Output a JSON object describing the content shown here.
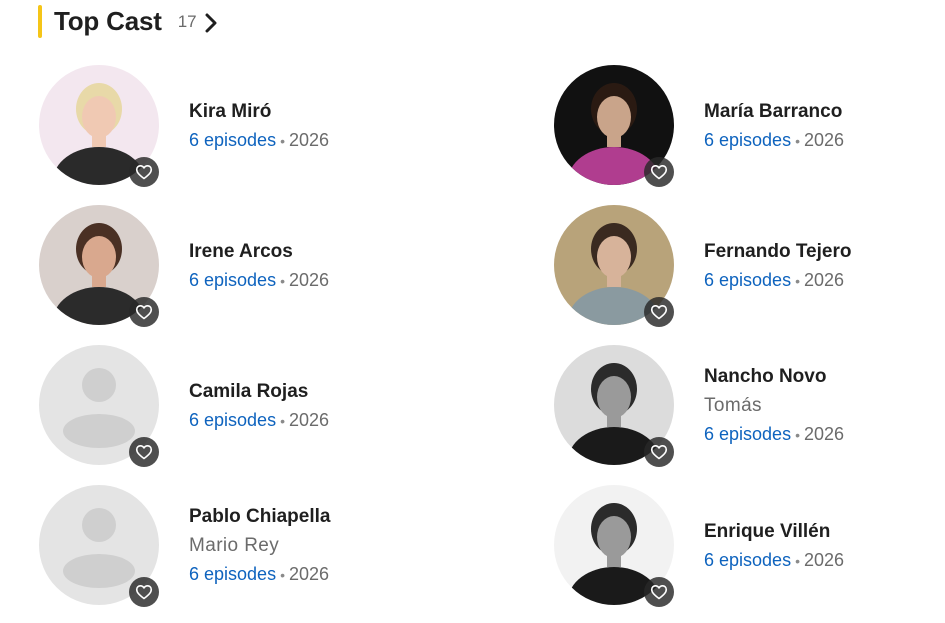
{
  "header": {
    "title": "Top Cast",
    "count": "17",
    "accent_color": "#f5c518",
    "chevron_icon": "chevron-right-icon"
  },
  "colors": {
    "link": "#0e63be",
    "muted": "#6b6b6b",
    "placeholder_bg": "#e4e4e4",
    "placeholder_fg": "#cfcfcf",
    "fav_button_bg": "#333333"
  },
  "cast": [
    {
      "name": "Kira Miró",
      "role": "",
      "episodes": "6 episodes",
      "year": "2026",
      "photo": "portrait-color",
      "fav_icon": "heart-outline-icon"
    },
    {
      "name": "María Barranco",
      "role": "",
      "episodes": "6 episodes",
      "year": "2026",
      "photo": "portrait-dark",
      "fav_icon": "heart-outline-icon"
    },
    {
      "name": "Irene Arcos",
      "role": "",
      "episodes": "6 episodes",
      "year": "2026",
      "photo": "portrait-color",
      "fav_icon": "heart-outline-icon"
    },
    {
      "name": "Fernando Tejero",
      "role": "",
      "episodes": "6 episodes",
      "year": "2026",
      "photo": "portrait-color",
      "fav_icon": "heart-outline-icon"
    },
    {
      "name": "Camila Rojas",
      "role": "",
      "episodes": "6 episodes",
      "year": "2026",
      "photo": "placeholder",
      "fav_icon": "heart-outline-icon"
    },
    {
      "name": "Nancho Novo",
      "role": "Tomás",
      "episodes": "6 episodes",
      "year": "2026",
      "photo": "portrait-bw",
      "fav_icon": "heart-outline-icon"
    },
    {
      "name": "Pablo Chiapella",
      "role": "Mario Rey",
      "episodes": "6 episodes",
      "year": "2026",
      "photo": "placeholder",
      "fav_icon": "heart-outline-icon"
    },
    {
      "name": "Enrique Villén",
      "role": "",
      "episodes": "6 episodes",
      "year": "2026",
      "photo": "portrait-bw",
      "fav_icon": "heart-outline-icon"
    }
  ]
}
